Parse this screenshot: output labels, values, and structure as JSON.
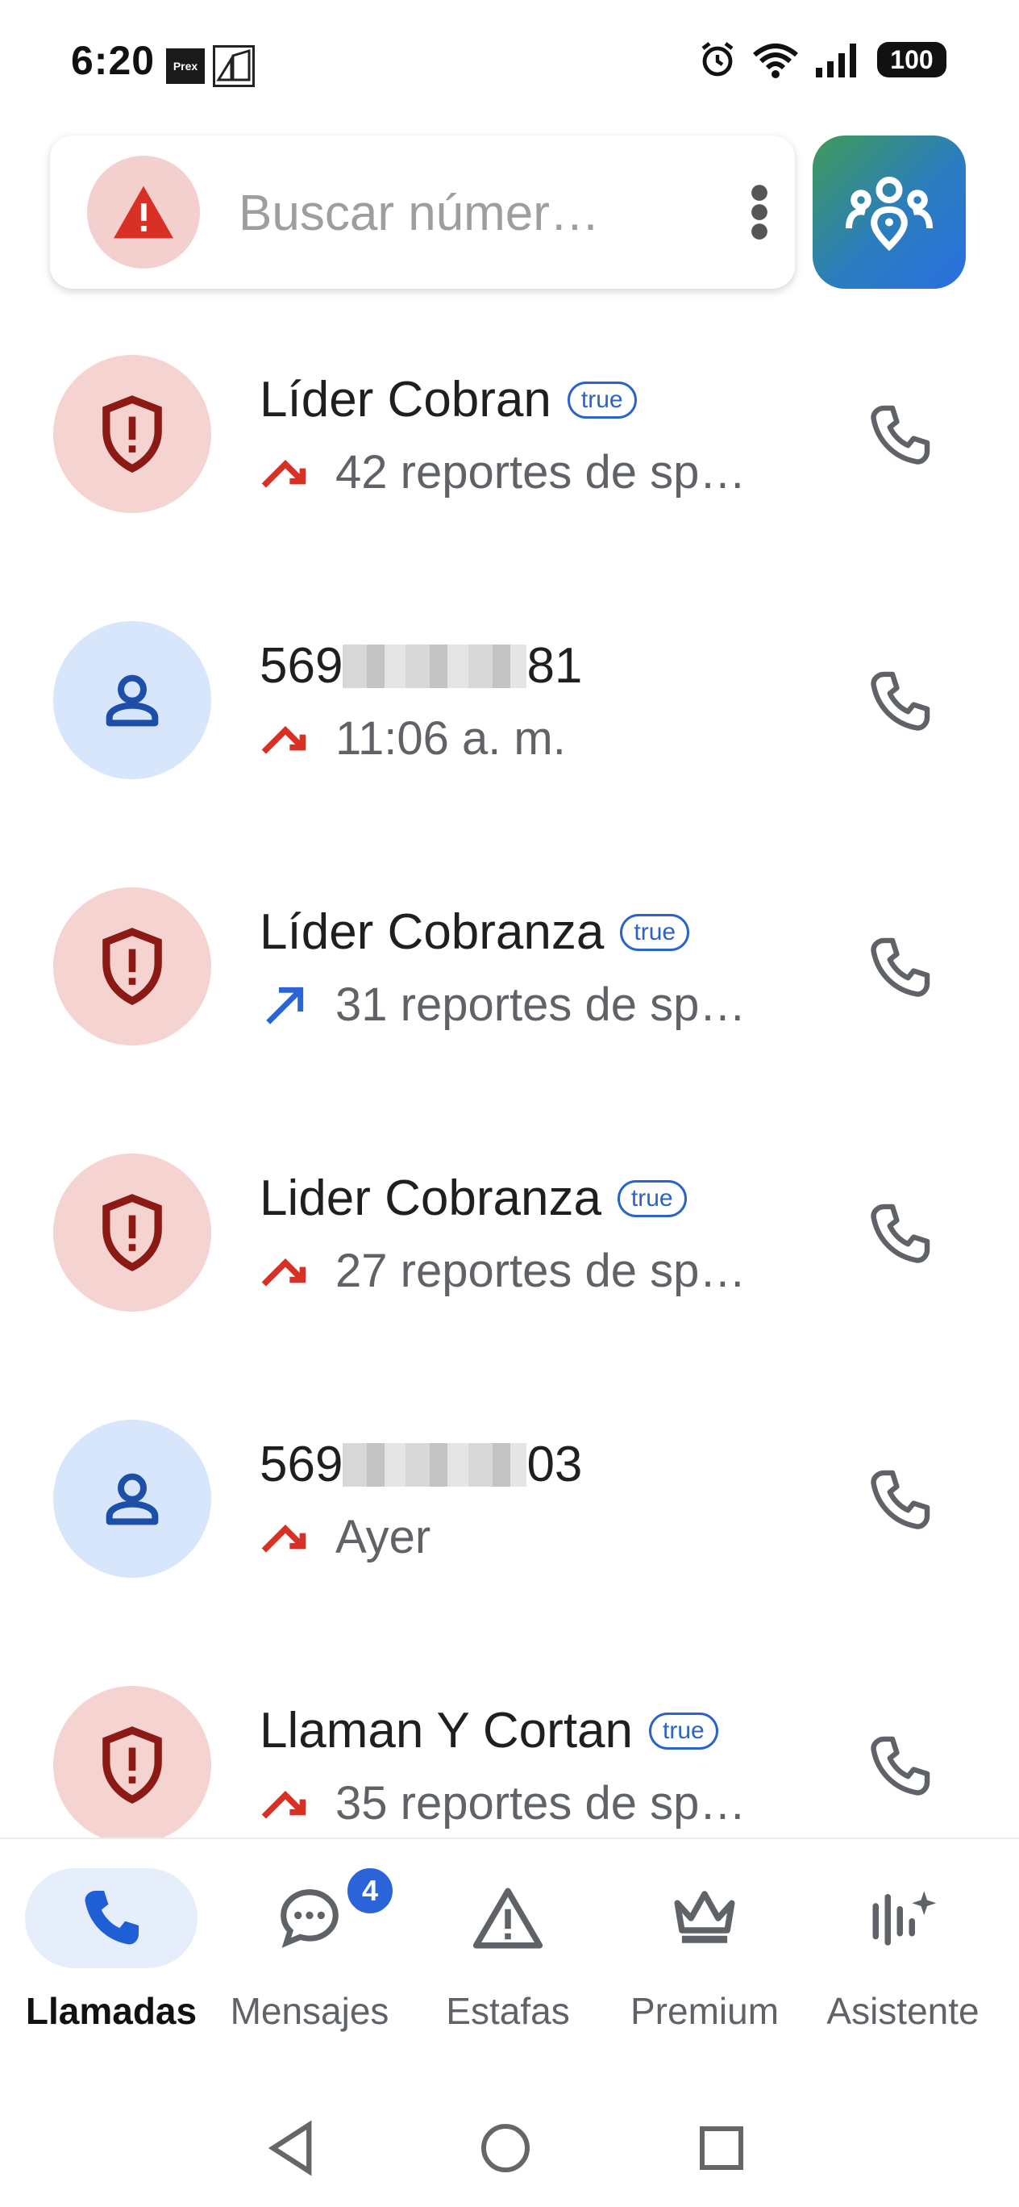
{
  "status_bar": {
    "time": "6:20",
    "app_icon_label": "Prex",
    "battery": "100"
  },
  "search": {
    "placeholder": "Buscar númer…"
  },
  "calls": [
    {
      "name": "Líder Cobran",
      "badge": "true",
      "detail": "42 reportes de sp…",
      "type": "spam",
      "direction": "missed"
    },
    {
      "name_prefix": "569",
      "name_suffix": "81",
      "detail": "11:06 a. m.",
      "type": "contact",
      "direction": "missed"
    },
    {
      "name": "Líder Cobranza",
      "badge": "true",
      "detail": "31 reportes de sp…",
      "type": "spam",
      "direction": "outgoing"
    },
    {
      "name": "Lider Cobranza",
      "badge": "true",
      "detail": "27 reportes de sp…",
      "type": "spam",
      "direction": "missed"
    },
    {
      "name_prefix": "569",
      "name_suffix": "03",
      "detail": "Ayer",
      "type": "contact",
      "direction": "missed"
    },
    {
      "name": "Llaman Y Cortan",
      "badge": "true",
      "detail": "35 reportes de sp…",
      "type": "spam",
      "direction": "missed"
    }
  ],
  "bottom_nav": {
    "items": [
      {
        "label": "Llamadas",
        "icon": "phone-icon",
        "active": true
      },
      {
        "label": "Mensajes",
        "icon": "chat-icon",
        "badge": "4"
      },
      {
        "label": "Estafas",
        "icon": "warning-icon"
      },
      {
        "label": "Premium",
        "icon": "crown-icon"
      },
      {
        "label": "Asistente",
        "icon": "assistant-icon"
      }
    ]
  },
  "colors": {
    "spam_bg": "#f5d3d0",
    "spam_icon": "#8b1a14",
    "contact_bg": "#d8e6fb",
    "contact_icon": "#1d4ea8",
    "missed_arrow": "#d93025",
    "outgoing_arrow": "#2b63d9",
    "accent": "#2b63d9"
  }
}
